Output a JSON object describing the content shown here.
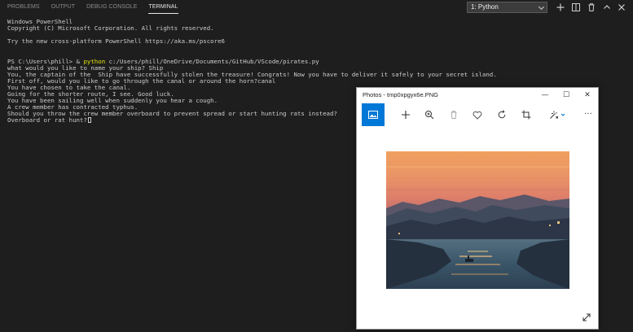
{
  "panel": {
    "tabs": [
      {
        "label": "PROBLEMS"
      },
      {
        "label": "OUTPUT"
      },
      {
        "label": "DEBUG CONSOLE"
      },
      {
        "label": "TERMINAL"
      }
    ],
    "active_tab": "TERMINAL",
    "terminal_select": {
      "value": "1: Python"
    },
    "icons": [
      "plus-icon",
      "split-icon",
      "trash-icon",
      "chevron-up-icon",
      "close-icon"
    ]
  },
  "terminal": {
    "lines": [
      "Windows PowerShell",
      "Copyright (C) Microsoft Corporation. All rights reserved.",
      "",
      "Try the new cross-platform PowerShell https://aka.ms/pscore6",
      "",
      "",
      "what would you like to name your ship? Ship",
      "You, the captain of the  Ship have successfully stolen the treasure! Congrats! Now you have to deliver it safely to your secret island.",
      "First off, would you like to go through the canal or around the horn?canal",
      "You have chosen to take the canal.",
      "Going for the shorter route, I see. Good luck.",
      "You have been sailing well when suddenly you hear a cough.",
      "A crew member has contracted typhus.",
      "Should you throw the crew member overboard to prevent spread or start hunting rats instead?",
      "Overboard or rat hunt?"
    ],
    "prompt_line": {
      "prompt": "PS C:\\Users\\phill> & ",
      "command": "python",
      "args": " c:/Users/phill/OneDrive/Documents/GitHub/VScode/pirates.py"
    },
    "command_color": "#e5e510"
  },
  "photos_window": {
    "title": "Photos - tmp0xpgyx6e.PNG",
    "window_buttons": {
      "minimize": "—",
      "maximize": "☐",
      "close": "✕"
    },
    "toolbar_icons": [
      "image-icon",
      "add-icon",
      "zoom-in-icon",
      "delete-icon",
      "heart-icon",
      "rotate-icon",
      "crop-icon",
      "edit-icon",
      "more-icon"
    ],
    "more_label": "···",
    "accent_color": "#0078d7"
  }
}
